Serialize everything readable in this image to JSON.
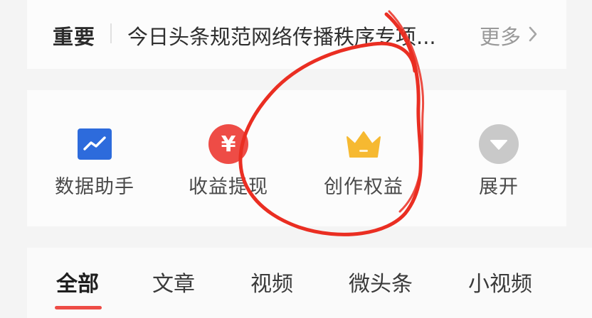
{
  "notice": {
    "tag": "重要",
    "text": "今日头条规范网络传播秩序专项...",
    "more": "更多"
  },
  "tools": [
    {
      "label": "数据助手",
      "icon": "trend-chart-icon",
      "color": "#2d6bdc"
    },
    {
      "label": "收益提现",
      "icon": "yuan-coin-icon",
      "color": "#ee4c46",
      "glyph": "¥"
    },
    {
      "label": "创作权益",
      "icon": "crown-icon",
      "color": "#f6b931"
    },
    {
      "label": "展开",
      "icon": "expand-down-icon",
      "color": "#c9c9c9"
    }
  ],
  "tabs": [
    {
      "label": "全部",
      "active": true
    },
    {
      "label": "文章"
    },
    {
      "label": "视频"
    },
    {
      "label": "微头条"
    },
    {
      "label": "小视频"
    }
  ],
  "colors": {
    "accent": "#ee4c46",
    "annotation_circle": "#ea2e22"
  }
}
